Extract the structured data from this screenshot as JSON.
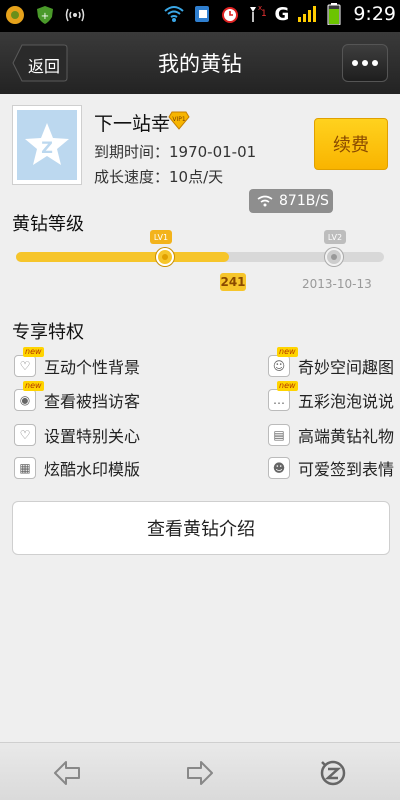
{
  "status_bar": {
    "time": "9:29",
    "network": "G",
    "icons": [
      "app-icon-1",
      "shield-icon",
      "antenna-icon",
      "wifi-icon",
      "sim-icon",
      "alarm-icon",
      "signal-icon",
      "battery-icon"
    ]
  },
  "header": {
    "back_label": "返回",
    "title": "我的黄钻",
    "more_icon": "more-dots-icon"
  },
  "profile": {
    "username": "下一站幸",
    "expire_text": "到期时间：1970-01-01",
    "growth_text": "成长速度：10点/天",
    "renew_label": "续费",
    "speed_text": "871B/S",
    "vip_badge": "VIP1"
  },
  "level": {
    "title": "黄钻等级",
    "current_level": "LV1",
    "next_level": "LV2",
    "current_value": "241",
    "progress": 0.58,
    "next_date": "2013-10-13"
  },
  "privileges": {
    "title": "专享特权",
    "new_label": "new",
    "items": [
      {
        "label": "互动个性背景",
        "icon": "heart-chat-icon",
        "new": true
      },
      {
        "label": "奇妙空间趣图",
        "icon": "smile-face-icon",
        "new": true
      },
      {
        "label": "查看被挡访客",
        "icon": "eye-icon",
        "new": true
      },
      {
        "label": "五彩泡泡说说",
        "icon": "chat-bubble-icon",
        "new": true
      },
      {
        "label": "设置特别关心",
        "icon": "heart-icon",
        "new": false
      },
      {
        "label": "高端黄钻礼物",
        "icon": "gift-icon",
        "new": false
      },
      {
        "label": "炫酷水印模版",
        "icon": "watermark-icon",
        "new": false
      },
      {
        "label": "可爱签到表情",
        "icon": "emoticon-icon",
        "new": false
      }
    ]
  },
  "intro_button_label": "查看黄钻介绍",
  "bottom_bar": {
    "icons": [
      "back-arrow-icon",
      "forward-arrow-icon",
      "qzone-logo-icon"
    ]
  },
  "colors": {
    "accent_yellow": "#f6c52a",
    "titlebar": "#2d2d2d",
    "background": "#efefef"
  }
}
